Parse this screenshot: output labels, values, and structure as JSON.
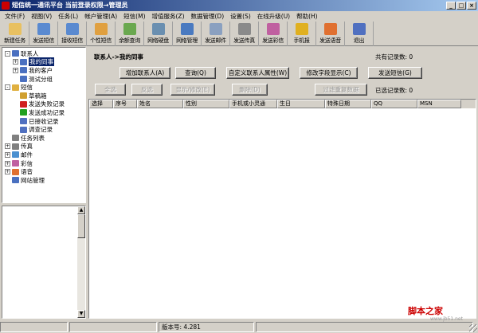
{
  "window": {
    "title": "短信统一通讯平台 当前登录权限→管理员",
    "min": "_",
    "max": "□",
    "close": "×"
  },
  "menu": [
    "文件(F)",
    "视图(V)",
    "任务(L)",
    "帐户管理(A)",
    "短信(M)",
    "增值服务(Z)",
    "数据管理(D)",
    "设置(S)",
    "在线升级(U)",
    "帮助(H)"
  ],
  "toolbar": [
    {
      "label": "新建任务",
      "icon": "new-task-icon",
      "color": "#e8c060"
    },
    {
      "label": "发送短信",
      "icon": "send-sms-icon",
      "color": "#5a8ad0"
    },
    {
      "label": "接收短信",
      "icon": "receive-sms-icon",
      "color": "#5a8ad0"
    },
    {
      "label": "个性短信",
      "icon": "custom-sms-icon",
      "color": "#e0a040"
    },
    {
      "label": "余额查询",
      "icon": "balance-icon",
      "color": "#6aa84f"
    },
    {
      "label": "网络硬盘",
      "icon": "disk-icon",
      "color": "#6a8fb0"
    },
    {
      "label": "网络管理",
      "icon": "network-icon",
      "color": "#4a7ac0"
    },
    {
      "label": "发送邮件",
      "icon": "email-icon",
      "color": "#8aa0c0"
    },
    {
      "label": "发送传真",
      "icon": "fax-icon",
      "color": "#8a8a8a"
    },
    {
      "label": "发送彩信",
      "icon": "mms-icon",
      "color": "#c060a0"
    },
    {
      "label": "手机报",
      "icon": "mobile-news-icon",
      "color": "#e0b020"
    },
    {
      "label": "发送语音",
      "icon": "voice-icon",
      "color": "#e07030"
    },
    {
      "label": "退出",
      "icon": "exit-icon",
      "color": "#5070c0"
    }
  ],
  "tree": [
    {
      "label": "联系人",
      "level": 0,
      "exp": "-",
      "icon": "contacts-icon",
      "color": "#4a70c0"
    },
    {
      "label": "我的同事",
      "level": 1,
      "exp": "+",
      "icon": "colleague-icon",
      "color": "#4a70c0",
      "selected": true
    },
    {
      "label": "我的客户",
      "level": 1,
      "exp": "+",
      "icon": "customer-icon",
      "color": "#4a70c0"
    },
    {
      "label": "测试分组",
      "level": 1,
      "exp": "",
      "icon": "group-icon",
      "color": "#4a70c0"
    },
    {
      "label": "短信",
      "level": 0,
      "exp": "-",
      "icon": "sms-folder-icon",
      "color": "#e0b040"
    },
    {
      "label": "草稿箱",
      "level": 1,
      "exp": "",
      "icon": "draft-icon",
      "color": "#d0a030"
    },
    {
      "label": "发送失败记录",
      "level": 1,
      "exp": "",
      "icon": "fail-icon",
      "color": "#d02020"
    },
    {
      "label": "发送成功记录",
      "level": 1,
      "exp": "",
      "icon": "success-icon",
      "color": "#20a020"
    },
    {
      "label": "已接收记录",
      "level": 1,
      "exp": "",
      "icon": "received-icon",
      "color": "#5070c0"
    },
    {
      "label": "调查记录",
      "level": 1,
      "exp": "",
      "icon": "survey-icon",
      "color": "#5070c0"
    },
    {
      "label": "任务列表",
      "level": 0,
      "exp": "",
      "icon": "tasklist-icon",
      "color": "#808080"
    },
    {
      "label": "传真",
      "level": 0,
      "exp": "+",
      "icon": "fax-folder-icon",
      "color": "#808080"
    },
    {
      "label": "邮件",
      "level": 0,
      "exp": "+",
      "icon": "mail-folder-icon",
      "color": "#4a90d0"
    },
    {
      "label": "彩信",
      "level": 0,
      "exp": "+",
      "icon": "mms-folder-icon",
      "color": "#c060a0"
    },
    {
      "label": "语音",
      "level": 0,
      "exp": "+",
      "icon": "voice-folder-icon",
      "color": "#e07030"
    },
    {
      "label": "网站管理",
      "level": 0,
      "exp": "",
      "icon": "site-icon",
      "color": "#4a70c0"
    }
  ],
  "main": {
    "breadcrumb": "联系人->我的同事",
    "total_label": "共有记录数: 0",
    "chosen_label": "已选记录数: 0",
    "buttons_row1": [
      "增加联系人(A)",
      "查询(Q)",
      "自定义联系人属性(W)",
      "修改字段显示(C)",
      "发送短信(G)"
    ],
    "buttons_row2": [
      "全选",
      "反选",
      "显示/修改(E)",
      "删除(D)",
      "过滤重复数据"
    ],
    "columns": [
      "选择",
      "序号",
      "姓名",
      "性别",
      "手机或小灵通",
      "生日",
      "特殊日期",
      "QQ",
      "MSN"
    ]
  },
  "status": {
    "version": "版本号: 4.281"
  },
  "watermark": {
    "text": "脚本之家",
    "url": "www.jb51.net"
  }
}
